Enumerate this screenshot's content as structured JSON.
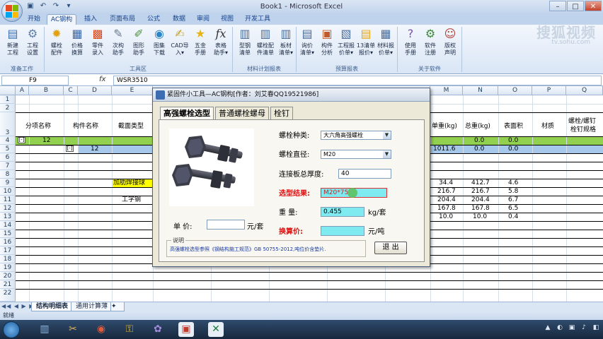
{
  "window": {
    "title": "Book1 - Microsoft Excel"
  },
  "ribbon": {
    "tabs": [
      "开始",
      "AC钢构",
      "插入",
      "页面布局",
      "公式",
      "数据",
      "审阅",
      "视图",
      "开发工具"
    ],
    "active_tab": "AC钢构",
    "buttons": [
      {
        "label": "新建\n工程",
        "icon": "new-project-icon"
      },
      {
        "label": "工程\n设置",
        "icon": "project-settings-icon"
      },
      {
        "label": "螺栓\n配件",
        "icon": "bolt-parts-icon"
      },
      {
        "label": "价格\n换算",
        "icon": "price-convert-icon"
      },
      {
        "label": "零件\n录入",
        "icon": "parts-entry-icon"
      },
      {
        "label": "次构\n助手",
        "icon": "secondary-helper-icon"
      },
      {
        "label": "图形\n助手",
        "icon": "graphics-helper-icon"
      },
      {
        "label": "图集\n下载",
        "icon": "atlas-download-icon"
      },
      {
        "label": "CAD导\n入▾",
        "icon": "cad-import-icon"
      },
      {
        "label": "五金\n手册",
        "icon": "hardware-manual-icon"
      },
      {
        "label": "表格\n助手▾",
        "icon": "table-helper-icon"
      },
      {
        "label": "型钢\n清单",
        "icon": "section-list-icon"
      },
      {
        "label": "螺栓配\n件清单",
        "icon": "bolt-list-icon"
      },
      {
        "label": "板材\n清单▾",
        "icon": "plate-list-icon"
      },
      {
        "label": "询价\n清单▾",
        "icon": "inquiry-list-icon"
      },
      {
        "label": "构件\n分析",
        "icon": "member-analysis-icon"
      },
      {
        "label": "工程报\n价单▾",
        "icon": "quote-icon"
      },
      {
        "label": "13清单\n报价▾",
        "icon": "list13-quote-icon"
      },
      {
        "label": "材料报\n价单▾",
        "icon": "material-quote-icon"
      },
      {
        "label": "使用\n手册",
        "icon": "help-icon"
      },
      {
        "label": "软件\n注册",
        "icon": "register-icon"
      },
      {
        "label": "版权\n声明",
        "icon": "copyright-icon"
      }
    ],
    "groups": [
      "准备工作",
      "工具区",
      "材料计划报表",
      "预算报表",
      "关于软件"
    ]
  },
  "formula_bar": {
    "name_box": "F9",
    "fx": "fx",
    "content": "WSR3510"
  },
  "sheet": {
    "columns": [
      "A",
      "B",
      "C",
      "D",
      "E",
      "M",
      "N",
      "O",
      "P",
      "Q"
    ],
    "rows": [
      "1",
      "2",
      "3",
      "4",
      "5",
      "6",
      "7",
      "8",
      "9",
      "10",
      "11",
      "12",
      "13",
      "14",
      "15",
      "16",
      "17",
      "18",
      "19",
      "20",
      "21",
      "22"
    ],
    "headers": {
      "fenxiang": "分项名称",
      "goujian": "构件名称",
      "jiemian": "截面类型",
      "danzhong": "单重(kg)",
      "zongzhong": "总重(kg)",
      "biaomian": "表面积",
      "caizhi": "材质",
      "luoshuan_l1": "螺栓/螺钉",
      "luoshuan_l2": "栓钉规格"
    },
    "outline_symbol": "[-]",
    "row4": {
      "b": "12",
      "n": "0.0",
      "o": "0.0"
    },
    "row5": {
      "d": "12",
      "m": "1011.6",
      "n": "0.0",
      "o": "0.0"
    },
    "e9": "加肋焊接球",
    "e11": "工字钢",
    "data_rows": [
      {
        "m": "34.4",
        "n": "412.7",
        "o": "4.6"
      },
      {
        "m": "216.7",
        "n": "216.7",
        "o": "5.8"
      },
      {
        "m": "204.4",
        "n": "204.4",
        "o": "6.7"
      },
      {
        "m": "167.8",
        "n": "167.8",
        "o": "6.5"
      },
      {
        "m": "10.0",
        "n": "10.0",
        "o": "0.4"
      }
    ],
    "tabs": [
      "结构明细表",
      "通用计算薄"
    ],
    "nav": "◀◀ ◀ ▶ ▶▶"
  },
  "status": {
    "text": "就绪"
  },
  "watermark": {
    "main": "搜狐视频",
    "sub": "tv.sohu.com"
  },
  "dialog": {
    "title": "紧固件小工具—AC钢构[作者：刘艾春QQ19521986]",
    "tabs": [
      "高强螺栓选型",
      "普通螺栓螺母",
      "栓钉"
    ],
    "active_tab": "高强螺栓选型",
    "bolt_type_label": "螺栓种类:",
    "bolt_type_value": "大六角高强螺栓",
    "bolt_diameter_label": "螺栓直径:",
    "bolt_diameter_value": "M20",
    "thickness_label": "连接板总厚度:",
    "thickness_value": "40",
    "result_label": "选型结果:",
    "result_value": "M20*75",
    "weight_label": "重   量:",
    "weight_value": "0.455",
    "weight_unit": "kg/套",
    "unit_price_label": "单  价:",
    "unit_price_value": "",
    "unit_price_unit": "元/套",
    "converted_label": "换算价:",
    "converted_value": "",
    "converted_unit": "元/吨",
    "note_title": "说明",
    "note_text": "高强螺栓选型参照《钢结构施工规范》GB 50755-2012,吨位价含垫片.",
    "exit_button": "退 出"
  }
}
